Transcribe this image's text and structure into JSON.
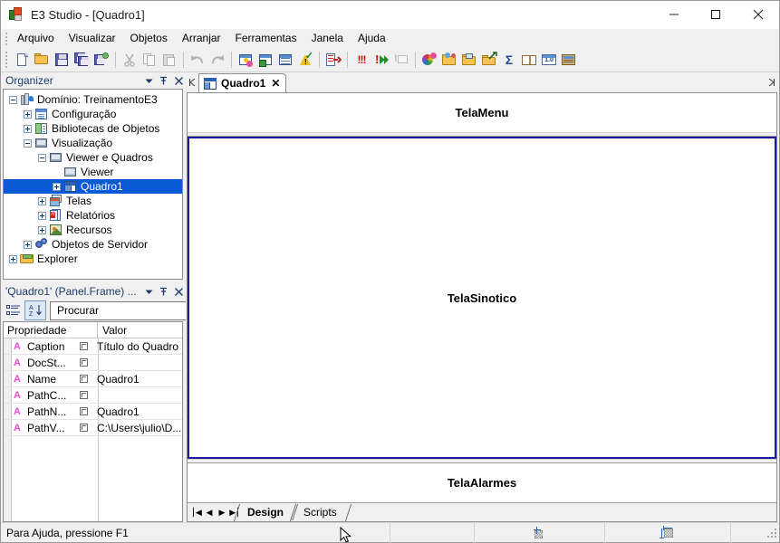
{
  "window": {
    "title": "E3 Studio - [Quadro1]",
    "icon": "app-icon",
    "minimize": "—",
    "maximize": "□",
    "close": "✕"
  },
  "menubar": {
    "items": [
      {
        "label": "Arquivo"
      },
      {
        "label": "Visualizar"
      },
      {
        "label": "Objetos"
      },
      {
        "label": "Arranjar"
      },
      {
        "label": "Ferramentas"
      },
      {
        "label": "Janela"
      },
      {
        "label": "Ajuda"
      }
    ]
  },
  "toolbar": {
    "groups": [
      [
        "new-document-icon",
        "open-folder-icon",
        "save-icon",
        "save-all-icon",
        "save-as-icon"
      ],
      [
        "cut-icon",
        "copy-icon",
        "paste-icon"
      ],
      [
        "undo-icon",
        "redo-icon"
      ],
      [
        "new-object-icon",
        "new-screen-icon",
        "new-report-icon",
        "verify-icon"
      ],
      [
        "export-icon"
      ],
      [
        "stop-all-icon",
        "run-icon",
        "message-icon"
      ],
      [
        "colors-icon",
        "gallery-icon",
        "library-icon",
        "link-icon",
        "sum-icon",
        "dictionary-icon",
        "scale-icon",
        "grid-icon"
      ]
    ]
  },
  "organizer": {
    "title": "Organizer",
    "dropdown_icon": "chevron-down-icon",
    "pin_icon": "pin-icon",
    "close_icon": "close-icon",
    "tree": [
      {
        "label": "Domínio: TreinamentoE3",
        "indent": 0,
        "expander": "minus",
        "icon": "domain-icon",
        "selected": false
      },
      {
        "label": "Configuração",
        "indent": 1,
        "expander": "plus",
        "icon": "config-icon",
        "selected": false
      },
      {
        "label": "Bibliotecas de Objetos",
        "indent": 1,
        "expander": "plus",
        "icon": "library-icon",
        "selected": false
      },
      {
        "label": "Visualização",
        "indent": 1,
        "expander": "minus",
        "icon": "monitor-icon",
        "selected": false
      },
      {
        "label": "Viewer e Quadros",
        "indent": 2,
        "expander": "minus",
        "icon": "monitor-icon",
        "selected": false
      },
      {
        "label": "Viewer",
        "indent": 3,
        "expander": "none",
        "icon": "monitor-icon",
        "selected": false
      },
      {
        "label": "Quadro1",
        "indent": 3,
        "expander": "plus",
        "icon": "quadro-icon",
        "selected": true
      },
      {
        "label": "Telas",
        "indent": 2,
        "expander": "plus",
        "icon": "screens-icon",
        "selected": false
      },
      {
        "label": "Relatórios",
        "indent": 2,
        "expander": "plus",
        "icon": "reports-icon",
        "selected": false
      },
      {
        "label": "Recursos",
        "indent": 2,
        "expander": "plus",
        "icon": "resources-icon",
        "selected": false
      },
      {
        "label": "Objetos de Servidor",
        "indent": 1,
        "expander": "plus",
        "icon": "server-objects-icon",
        "selected": false
      },
      {
        "label": "Explorer",
        "indent": 0,
        "expander": "plus",
        "icon": "explorer-folder-icon",
        "selected": false
      }
    ]
  },
  "properties": {
    "title": "'Quadro1' (Panel.Frame) ...",
    "dropdown_icon": "chevron-down-icon",
    "pin_icon": "pin-icon",
    "close_icon": "close-icon",
    "categorize_button": "categorized-view-icon",
    "sort_button": "alphabetical-sort-icon",
    "search": {
      "placeholder": "Procurar",
      "value": "",
      "icon": "search-icon"
    },
    "columns": {
      "name": "Propriedade",
      "value": "Valor"
    },
    "rows": [
      {
        "type": "A",
        "name": "Caption",
        "value": "Título do Quadro"
      },
      {
        "type": "A",
        "name": "DocSt...",
        "value": ""
      },
      {
        "type": "A",
        "name": "Name",
        "value": "Quadro1"
      },
      {
        "type": "A",
        "name": "PathC...",
        "value": ""
      },
      {
        "type": "A",
        "name": "PathN...",
        "value": "Quadro1"
      },
      {
        "type": "A",
        "name": "PathV...",
        "value": "C:\\Users\\julio\\D..."
      }
    ]
  },
  "document": {
    "scroll_left_icon": "scroll-left-icon",
    "scroll_right_icon": "scroll-right-icon",
    "tab": {
      "label": "Quadro1",
      "icon": "quadro-icon",
      "close": "✕"
    },
    "regions": [
      {
        "name": "TelaMenu",
        "selected": false
      },
      {
        "name": "TelaSinotico",
        "selected": true
      },
      {
        "name": "TelaAlarmes",
        "selected": false
      }
    ],
    "selection_color": "#1a1a9a",
    "page_nav": [
      "⎮◀",
      "◀",
      "▶",
      "▶⎮"
    ],
    "page_tabs": [
      {
        "label": "Design",
        "active": true
      },
      {
        "label": "Scripts",
        "active": false
      }
    ]
  },
  "statusbar": {
    "message": "Para Ajuda, pressione F1",
    "cells": [
      "",
      "position-icon",
      "size-icon",
      ""
    ],
    "resize_grip": "resize-grip-icon"
  }
}
